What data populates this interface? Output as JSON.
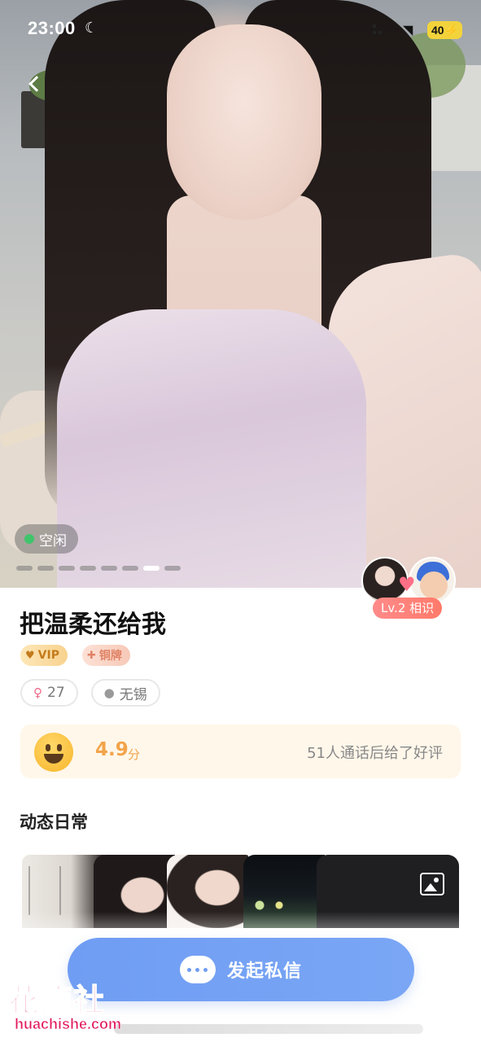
{
  "status_bar": {
    "time": "23:00",
    "battery": "40",
    "moon_icon": "moon-icon",
    "wifi_icon": "wifi-icon"
  },
  "photo": {
    "status_label": "空闲",
    "status_color": "#40c46b",
    "carousel_count": 8,
    "carousel_active": 7
  },
  "match": {
    "level_label": "Lv.2 相识"
  },
  "profile": {
    "name": "把温柔还给我",
    "badges": [
      {
        "label": "VIP",
        "icon": "crown-icon"
      },
      {
        "label": "铜牌",
        "icon": "medal-icon"
      }
    ],
    "age": "27",
    "location": "无锡"
  },
  "rating": {
    "score": "4.9",
    "unit": "分",
    "summary": "51人通话后给了好评"
  },
  "moments": {
    "title": "动态日常"
  },
  "cta": {
    "label": "发起私信"
  },
  "watermark": {
    "cn": "花痴社",
    "en": "huachishe.com"
  },
  "colors": {
    "accent_blue": "#6f9df3",
    "score_orange": "#f2a44a",
    "brand_pink": "#e2185c"
  }
}
